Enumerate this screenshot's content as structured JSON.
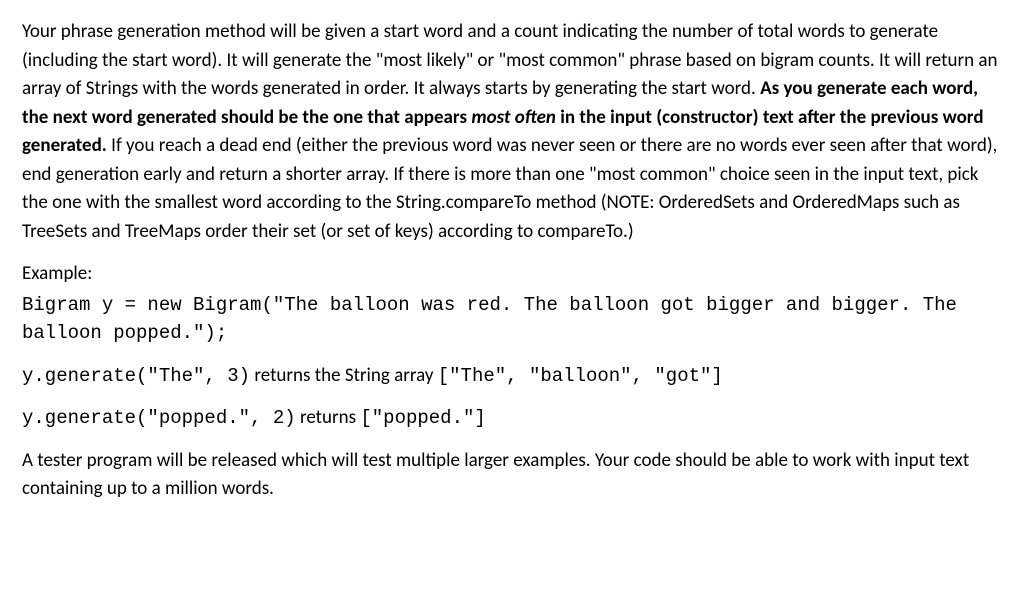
{
  "para1": {
    "t1": "Your phrase generation method will be given a start word and a count indicating the number of total words to generate (including the start word). It will generate the \"most likely\" or \"most common\" phrase based on bigram counts. It will return an array of Strings with the words generated in order. It always starts by generating the start word. ",
    "bold1": "As you generate each word, the next word generated should be the one that appears ",
    "boldItalic": "most often",
    "bold2": " in the input (constructor) text after the previous word generated.",
    "t2": " If you reach a dead end (either the previous word was never seen or there are no words ever seen after that word), end generation early and return a shorter array. If there is more than one \"most common\" choice seen in the input text, pick the one with the smallest word according to the String.compareTo method (NOTE: OrderedSets and OrderedMaps such as TreeSets and TreeMaps order their set (or set of keys) according to compareTo.)"
  },
  "exampleLabel": "Example:",
  "codeBlock1": "Bigram y = new Bigram(\"The balloon was red. The balloon got bigger and bigger. The balloon popped.\");",
  "line2": {
    "code1": "y.generate(\"The\", 3)",
    "text1": " returns the String array ",
    "code2": "[\"The\", \"balloon\", \"got\"]"
  },
  "line3": {
    "code1": "y.generate(\"popped.\", 2)",
    "text1": " returns ",
    "code2": "[\"popped.\"]"
  },
  "para4": "A tester program will be released which will test multiple larger examples. Your code should be able to work with input text containing up to a million words."
}
